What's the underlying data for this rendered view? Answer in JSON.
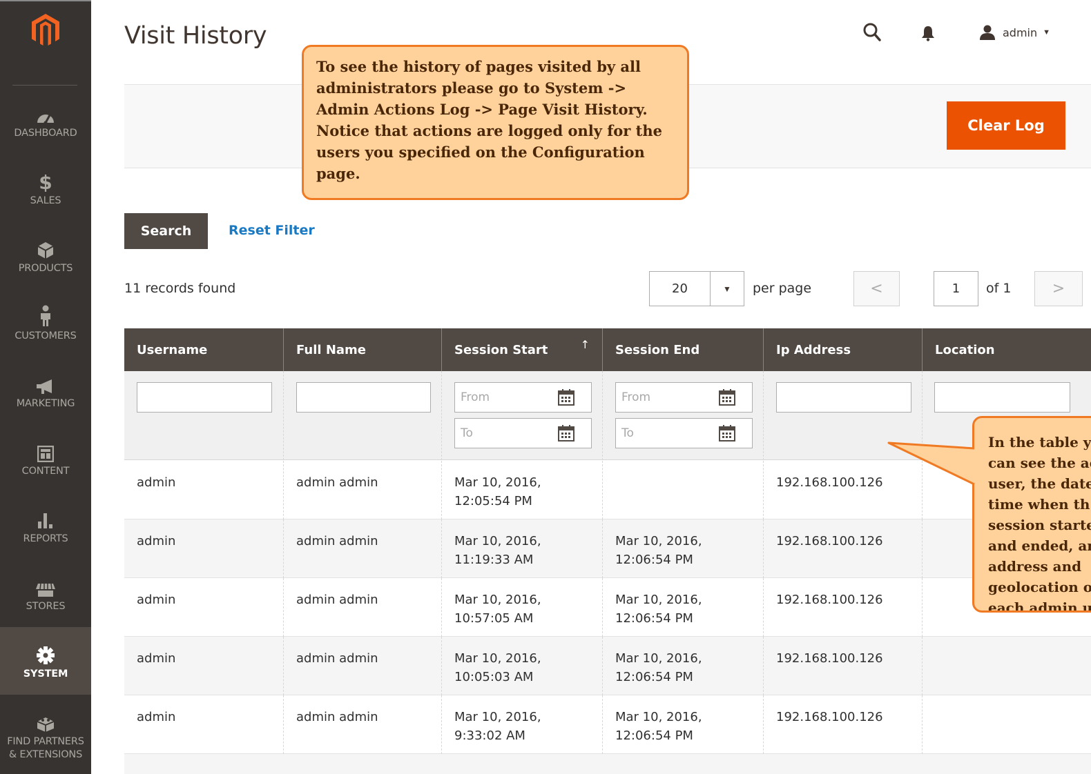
{
  "sidebar": {
    "items": [
      {
        "label": "DASHBOARD",
        "icon": "dashboard-icon"
      },
      {
        "label": "SALES",
        "icon": "dollar-icon"
      },
      {
        "label": "PRODUCTS",
        "icon": "box-icon"
      },
      {
        "label": "CUSTOMERS",
        "icon": "person-icon"
      },
      {
        "label": "MARKETING",
        "icon": "megaphone-icon"
      },
      {
        "label": "CONTENT",
        "icon": "layout-icon"
      },
      {
        "label": "REPORTS",
        "icon": "bar-chart-icon"
      },
      {
        "label": "STORES",
        "icon": "storefront-icon"
      },
      {
        "label": "SYSTEM",
        "icon": "gear-icon",
        "active": true
      },
      {
        "label_line1": "FIND PARTNERS",
        "label_line2": "& EXTENSIONS",
        "icon": "blocks-icon"
      }
    ]
  },
  "header": {
    "title": "Visit History",
    "user": "admin"
  },
  "actions": {
    "clear_log": "Clear Log"
  },
  "callouts": {
    "top": "To see the history of pages visited by all administrators please go to System -> Admin Actions Log -> Page Visit History. Notice that actions are logged only for the users you specified on the Configuration page.",
    "right_lines": [
      "In the table y",
      "can see the ac",
      "user, the date",
      "time when th",
      "session starte",
      "and ended, an",
      "address and",
      "geolocation o",
      "each admin u"
    ]
  },
  "search": {
    "search_label": "Search",
    "reset_label": "Reset Filter"
  },
  "pager": {
    "records": "11 records found",
    "per_page_value": "20",
    "per_page_label": "per page",
    "page": "1",
    "of": "of 1",
    "prev": "<",
    "next": ">"
  },
  "grid": {
    "columns": [
      "Username",
      "Full Name",
      "Session Start",
      "Session End",
      "Ip Address",
      "Location"
    ],
    "sort_indicator": "↑",
    "filters": {
      "from": "From",
      "to": "To"
    },
    "rows": [
      {
        "username": "admin",
        "full_name": "admin admin",
        "start_date": "Mar 10, 2016,",
        "start_time": "12:05:54 PM",
        "end_date": "",
        "end_time": "",
        "ip": "192.168.100.126",
        "location": ""
      },
      {
        "username": "admin",
        "full_name": "admin admin",
        "start_date": "Mar 10, 2016,",
        "start_time": "11:19:33 AM",
        "end_date": "Mar 10, 2016,",
        "end_time": "12:06:54 PM",
        "ip": "192.168.100.126",
        "location": ""
      },
      {
        "username": "admin",
        "full_name": "admin admin",
        "start_date": "Mar 10, 2016,",
        "start_time": "10:57:05 AM",
        "end_date": "Mar 10, 2016,",
        "end_time": "12:06:54 PM",
        "ip": "192.168.100.126",
        "location": ""
      },
      {
        "username": "admin",
        "full_name": "admin admin",
        "start_date": "Mar 10, 2016,",
        "start_time": "10:05:03 AM",
        "end_date": "Mar 10, 2016,",
        "end_time": "12:06:54 PM",
        "ip": "192.168.100.126",
        "location": ""
      },
      {
        "username": "admin",
        "full_name": "admin admin",
        "start_date": "Mar 10, 2016,",
        "start_time": "9:33:02 AM",
        "end_date": "Mar 10, 2016,",
        "end_time": "12:06:54 PM",
        "ip": "192.168.100.126",
        "location": ""
      }
    ]
  },
  "colors": {
    "sidebar_bg": "#373330",
    "sidebar_active": "#514943",
    "primary_button": "#eb5202",
    "grid_header": "#514943",
    "link": "#1979c3",
    "callout_fill": "#ffd29c",
    "callout_border": "#f07a23"
  }
}
